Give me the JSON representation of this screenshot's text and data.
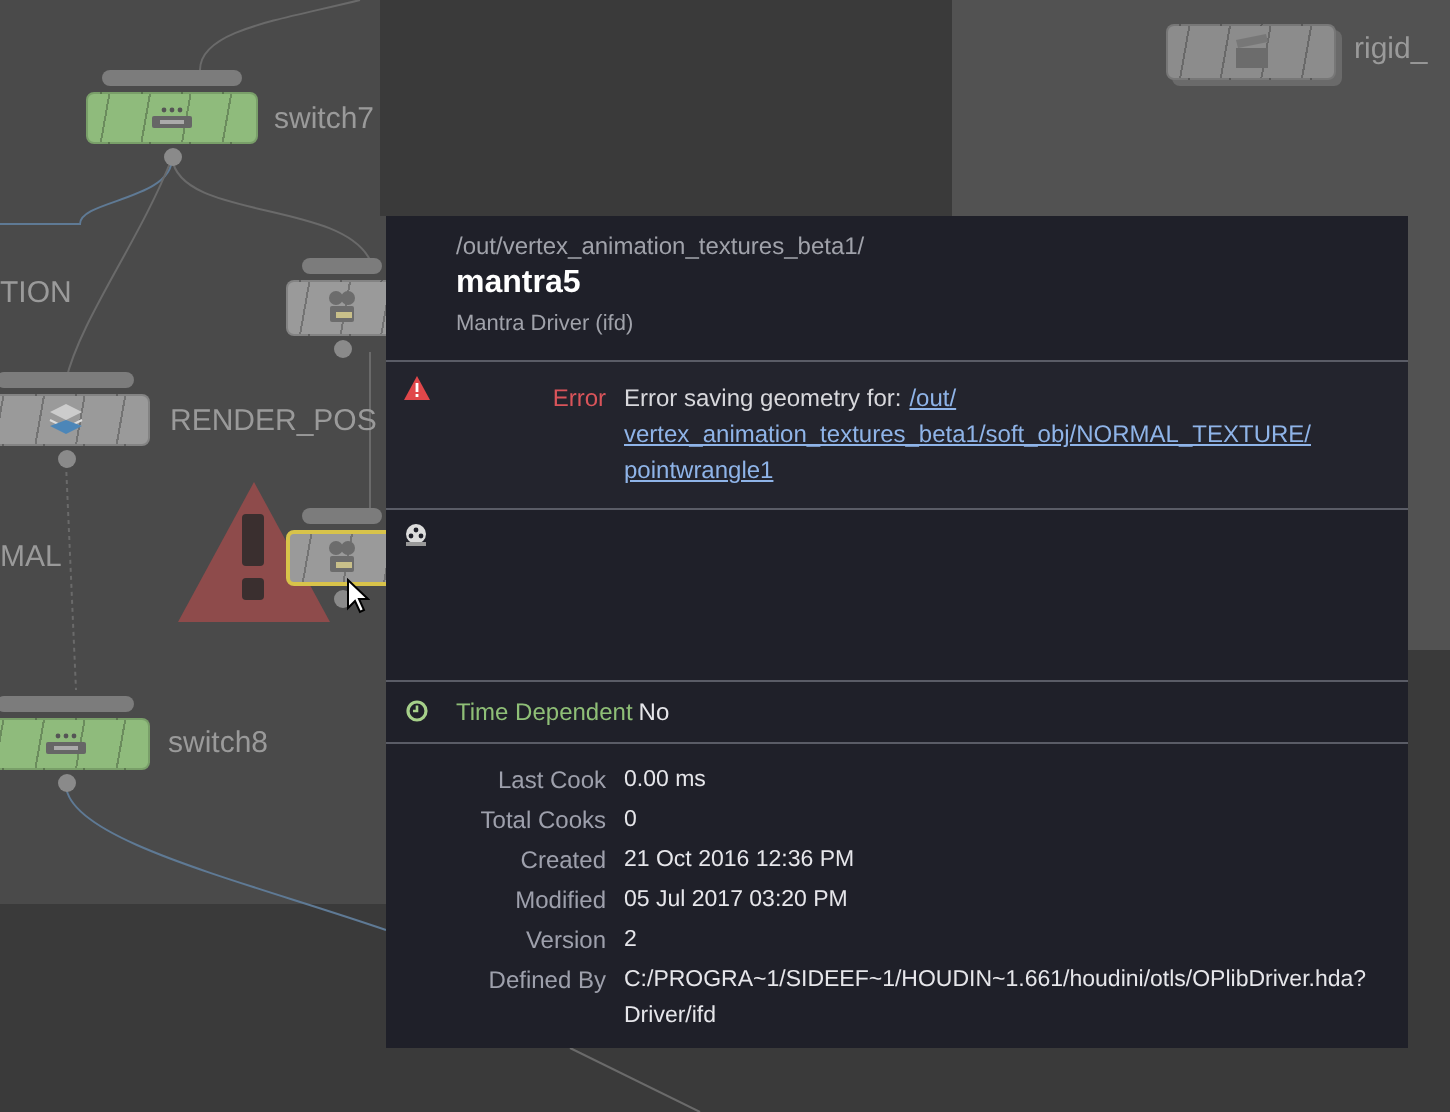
{
  "network": {
    "nodes": [
      {
        "kind": "switch",
        "label": "switch7",
        "color": "#8fbb7c",
        "selected": false,
        "error": false
      },
      {
        "kind": "offscreen",
        "label": "TION"
      },
      {
        "kind": "camera",
        "color": "#9a9a9a",
        "selected": false,
        "error": false
      },
      {
        "kind": "render",
        "label": "RENDER_POS",
        "color": "#9a9a9a",
        "selected": false,
        "error": false
      },
      {
        "kind": "offscreen",
        "label": "MAL"
      },
      {
        "kind": "camera",
        "color": "#9a9a9a",
        "selected": true,
        "error": true
      },
      {
        "kind": "switch",
        "label": "switch8",
        "color": "#8fbb7c",
        "selected": false,
        "error": false
      },
      {
        "kind": "clapper",
        "label": "rigid_",
        "color": "#8c8c8c",
        "selected": false,
        "error": false
      }
    ]
  },
  "info": {
    "path": "/out/vertex_animation_textures_beta1/",
    "name": "mantra5",
    "type": "Mantra Driver (ifd)",
    "error": {
      "label": "Error",
      "message": "Error saving geometry for:",
      "link_lines": [
        "/out/",
        "vertex_animation_textures_beta1/soft_obj/NORMAL_TEXTURE/",
        "pointwrangle1"
      ]
    },
    "time_dependent": {
      "label": "Time Dependent",
      "value": "No"
    },
    "stats": [
      {
        "label": "Last Cook",
        "value": "0.00 ms"
      },
      {
        "label": "Total Cooks",
        "value": "0"
      },
      {
        "label": "Created",
        "value": "21 Oct 2016 12:36 PM"
      },
      {
        "label": "Modified",
        "value": "05 Jul 2017 03:20 PM"
      },
      {
        "label": "Version",
        "value": "2"
      },
      {
        "label": "Defined By",
        "value": "C:/PROGRA~1/SIDEEF~1/HOUDIN~1.661/houdini/otls/OPlibDriver.hda?\nDriver/ifd"
      }
    ]
  }
}
